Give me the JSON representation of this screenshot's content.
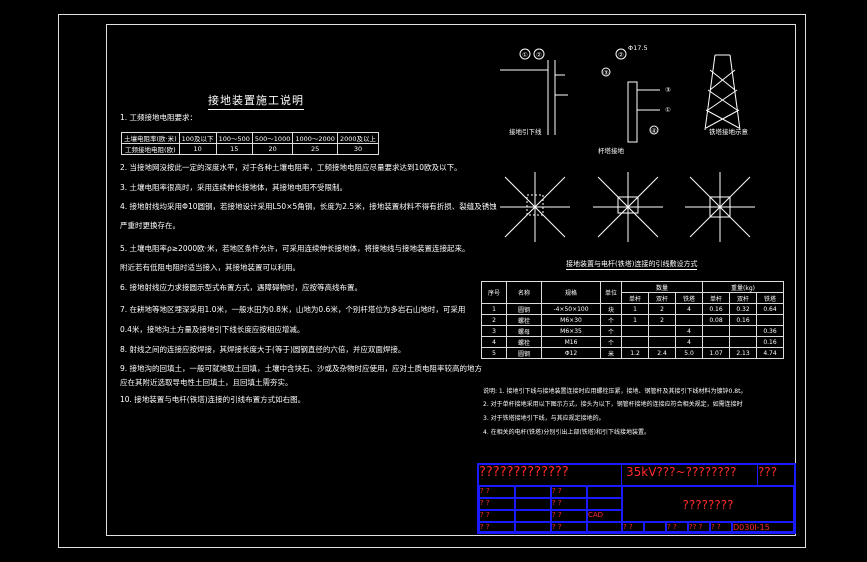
{
  "drawing": {
    "title": "接地装置施工说明",
    "notes": [
      "1. 工频接地电阻要求：",
      "2. 当接地网没按此一定的深度水平，对于各种土壤电阻率，工频接地电阻应尽量要求达到10欧及以下。",
      "3. 土壤电阻率很高时，采用连续伸长接地体，其接地电阻不受限制。",
      "4. 接地射线均采用Φ10圆钢，若接地设计采用L50×5角钢，长度为2.5米，接地装置材料不得有折损、裂缝及锈蚀",
      "   严重时更换存在。",
      "5. 土壤电阻率ρ≥2000欧·米，若地区条件允许，可采用连续伸长接地体，将接地线与接地装置连接起来。",
      "   附近若有低阻电阻时适当接入，其接地装置可以利用。",
      "6. 接地射线应力求接圆示型式布置方式，遇障碍物时，应按等高线布置。",
      "7. 在耕地等地区埋深采用1.0米，一般水田为0.8米，山地为0.6米，个别杆塔位为多岩石山地时，可采用",
      "   0.4米，接地沟土方量及接地引下线长度应按相应增减。",
      "8. 射线之间的连接应按焊接，其焊接长度大于(等于)圆钢直径的六倍，并应双面焊接。",
      "9. 接地沟的回填土，一般可就地取土回填，土壤中含块石、沙或及杂物时应使用，应对土质电阻率较高的地方",
      "   应在其附近选取导电性土回填土，且回填土需夯实。",
      "10. 接地装置与电杆(铁塔)连接的引线布置方式如右图。"
    ],
    "resistance_table": {
      "row1": [
        "土壤电阻率(欧·米)",
        "100及以下",
        "100～500",
        "500～1000",
        "1000～2000",
        "2000及以上"
      ],
      "row2": [
        "工频接地电阻(欧)",
        "10",
        "15",
        "20",
        "25",
        "30"
      ]
    },
    "fig_labels": [
      "接地引下线 ",
      "杆塔接地 ",
      "铁塔接地示意"
    ],
    "fig_marks": [
      "①",
      "②",
      "③",
      "④",
      "Φ17.5",
      "②",
      "③",
      "①"
    ],
    "materials_title": "接地装置与电杆(铁塔)连接的引线敷设方式",
    "materials_headers": [
      "序号",
      "名称",
      "规格",
      "单位",
      "数量",
      "重量(kg)"
    ],
    "materials_subheaders": [
      "单杆",
      "双杆",
      "铁塔",
      "单杆",
      "双杆",
      "铁塔"
    ],
    "materials_rows": [
      [
        "1",
        "圆钢",
        "-4×50×100",
        "块",
        "1",
        "2",
        "4",
        "0.16",
        "0.32",
        "0.64"
      ],
      [
        "2",
        "螺栓",
        "M6×30",
        "个",
        "1",
        "2",
        "",
        "0.08",
        "0.16",
        ""
      ],
      [
        "3",
        "螺母",
        "M6×35",
        "个",
        "",
        "",
        "4",
        "",
        "",
        "0.36"
      ],
      [
        "4",
        "螺栓",
        "M16",
        "个",
        "",
        "",
        "4",
        "",
        "",
        "0.16"
      ],
      [
        "5",
        "圆钢",
        "Φ12",
        "米",
        "1.2",
        "2.4",
        "5.0",
        "1.07",
        "2.13",
        "4.74"
      ]
    ],
    "legend": [
      "说明: 1. 接地引下线与接地装置连接时应用螺栓压紧，接地、钢管杆及其接引下线材料为镀锌0.8t。",
      "      2. 对于单杆接地采用以下图示方式，接头为以下，钢管杆接地的连接应符合相关规定，如需连接时",
      "      3. 对于铁塔接地引下线，与其应规定接地的。",
      "      4. 在相关的电杆(铁塔)分别引出上部(铁塔)和引下线接地装置。"
    ],
    "title_block": {
      "company": "?????????????",
      "project": "35kV???~????????",
      "project_suffix": "???",
      "drawing_name": "????????",
      "cad_label": "CAD",
      "drawing_no": "D030I-15",
      "small_left": [
        "? ?",
        "? ?",
        "? ?",
        "? ?"
      ],
      "small_mid": [
        "? ?",
        "? ?",
        "? ?",
        "? ?"
      ],
      "bottom_row": [
        "? ?",
        "? ?",
        "?? ?",
        "? ?"
      ]
    }
  },
  "colors": {
    "background": "#000000",
    "lines": "#ffffff",
    "title_block_border": "#1a1aff",
    "title_block_text": "#ff2a2a"
  }
}
